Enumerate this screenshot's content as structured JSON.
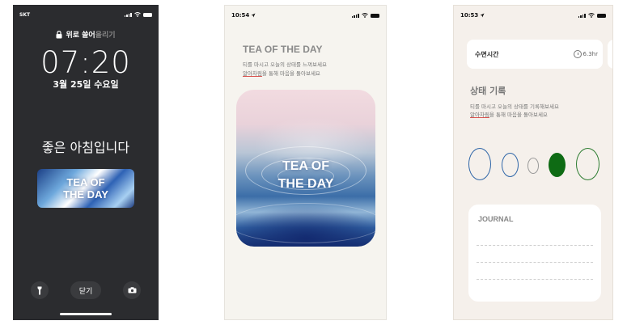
{
  "lockscreen": {
    "carrier": "SKT",
    "lock_label": "위로 쓸어",
    "lock_label_dim": "올리기",
    "time": "07:20",
    "date": "3월 25일 수요일",
    "greeting": "좋은 아침입니다",
    "widget_line1": "TEA OF",
    "widget_line2": "THE DAY",
    "close_label": "닫기",
    "icons": [
      "flashlight-icon",
      "camera-icon",
      "lock-icon",
      "wifi-icon",
      "battery-icon"
    ]
  },
  "tea_screen": {
    "status_time": "10:54",
    "title": "TEA OF THE DAY",
    "subtitle_line1": "티를 마시고 오늘의 상태를 느껴보세요",
    "subtitle_line2_underlined": "알아차림",
    "subtitle_line2_rest": "을 통해 마음을 돌아보세요",
    "card_line1": "TEA OF",
    "card_line2": "THE DAY"
  },
  "status_screen": {
    "status_time": "10:53",
    "sleep_label": "수면시간",
    "sleep_value": "6.3hr",
    "section_title": "상태 기록",
    "subtitle_line1": "티를 마시고 오늘의 상태를 기록해보세요",
    "subtitle_line2_underlined": "알아차림",
    "subtitle_line2_rest": "을 통해 마음을 돌아보세요",
    "mood_options": [
      {
        "name": "mood-very-bad",
        "style": "outline",
        "color": "#2f66a8"
      },
      {
        "name": "mood-bad",
        "style": "outline",
        "color": "#2f66a8"
      },
      {
        "name": "mood-neutral",
        "style": "outline",
        "color": "#999999"
      },
      {
        "name": "mood-good",
        "style": "filled",
        "color": "#0e6b14"
      },
      {
        "name": "mood-very-good",
        "style": "outline",
        "color": "#2e7d32"
      }
    ],
    "journal_title": "JOURNAL"
  }
}
